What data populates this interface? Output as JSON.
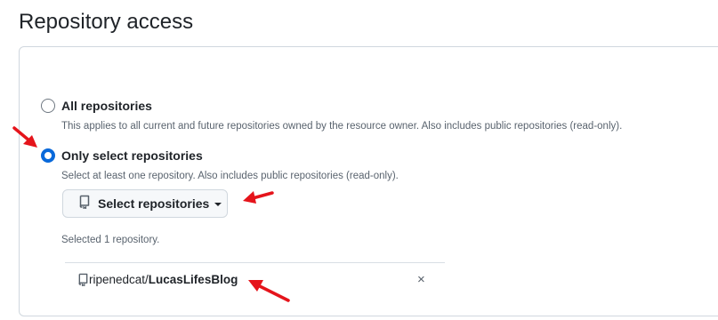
{
  "section": {
    "title": "Repository access"
  },
  "options": [
    {
      "label": "All repositories",
      "description": "This applies to all current and future repositories owned by the resource owner. Also includes public repositories (read-only).",
      "selected": false
    },
    {
      "label": "Only select repositories",
      "description": "Select at least one repository. Also includes public repositories (read-only).",
      "selected": true
    }
  ],
  "select_button": {
    "label": "Select repositories",
    "icon": "repo-icon"
  },
  "selected_summary": "Selected 1 repository.",
  "selected_repos": [
    {
      "owner": "ripenedcat/",
      "name": "LucasLifesBlog",
      "remove_label": "×"
    }
  ],
  "colors": {
    "accent": "#0969da",
    "annotation_arrow": "#e5141b"
  }
}
